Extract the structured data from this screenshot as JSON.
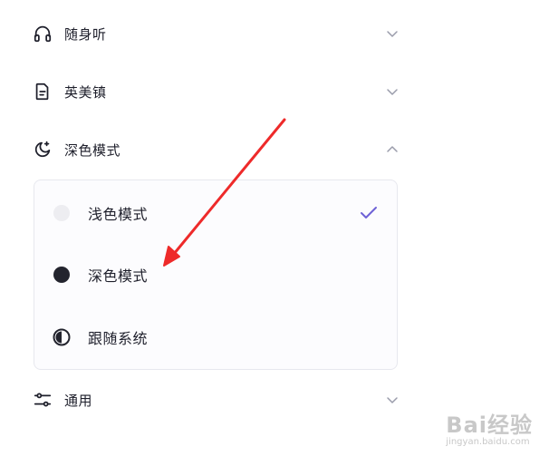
{
  "menu": {
    "items": [
      {
        "label": "随身听",
        "icon": "headphones-icon",
        "state": "collapsed"
      },
      {
        "label": "英美镇",
        "icon": "document-icon",
        "state": "collapsed"
      },
      {
        "label": "深色模式",
        "icon": "moon-icon",
        "state": "expanded"
      },
      {
        "label": "通用",
        "icon": "sliders-icon",
        "state": "collapsed"
      }
    ]
  },
  "theme_options": [
    {
      "label": "浅色模式",
      "icon": "light-dot-icon",
      "selected": true
    },
    {
      "label": "深色模式",
      "icon": "dark-dot-icon",
      "selected": false
    },
    {
      "label": "跟随系统",
      "icon": "half-circle-icon",
      "selected": false
    }
  ],
  "colors": {
    "text": "#1e1f2b",
    "chevron": "#9a9cab",
    "check": "#6e62d6",
    "arrow": "#ee2a2a",
    "light_dot": "#ededf1",
    "dark_dot": "#23242e"
  },
  "watermark": {
    "logo": "Bai经验",
    "url": "jingyan.baidu.com"
  }
}
